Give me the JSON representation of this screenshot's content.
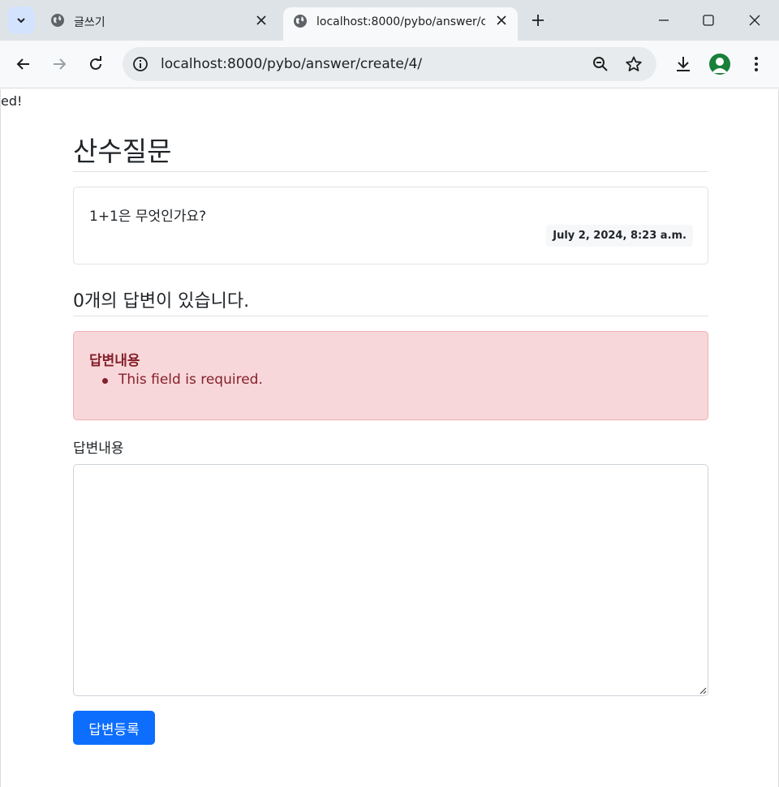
{
  "browser": {
    "tabs": [
      {
        "title": "글쓰기",
        "icon": "globe-icon",
        "active": false
      },
      {
        "title": "localhost:8000/pybo/answer/create/4/",
        "icon": "globe-icon",
        "active": true
      }
    ],
    "address_bar": {
      "url": "localhost:8000/pybo/answer/create/4/"
    },
    "colors": {
      "tabbar": "#dee3e7",
      "toolbar": "#f7f9fa",
      "profile": "#188038"
    }
  },
  "page": {
    "stray_text": "ed!",
    "question": {
      "subject": "산수질문",
      "content": "1+1은 무엇인가요?",
      "create_date": "July 2, 2024, 8:23 a.m."
    },
    "answer_count_text": "0개의 답변이 있습니다.",
    "error_alert": {
      "field_label": "답변내용",
      "messages": [
        "This field is required."
      ]
    },
    "form": {
      "label": "답변내용",
      "content_value": "",
      "submit_label": "답변등록"
    },
    "colors": {
      "primary": "#0d6efd",
      "alert_bg": "#f8d7da",
      "alert_text": "#842029"
    }
  }
}
